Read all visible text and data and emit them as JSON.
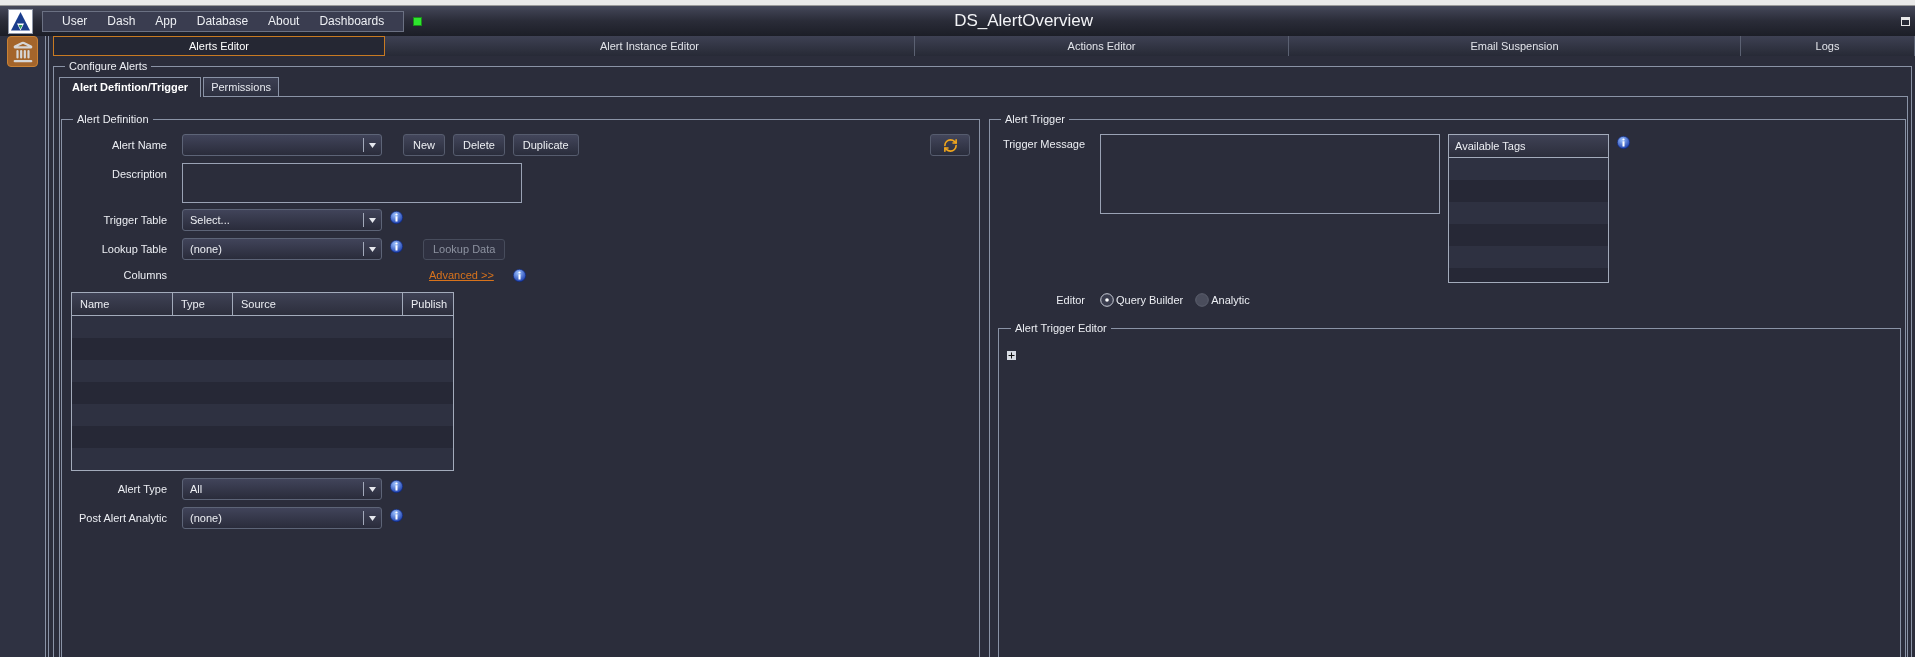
{
  "window": {
    "title": "DS_AlertOverview"
  },
  "menu": [
    {
      "label": "User"
    },
    {
      "label": "Dash"
    },
    {
      "label": "App"
    },
    {
      "label": "Database"
    },
    {
      "label": "About"
    },
    {
      "label": "Dashboards"
    }
  ],
  "status_light": {
    "on": true
  },
  "sidebar": {
    "items": [
      {
        "selected": true
      }
    ]
  },
  "tabs": [
    {
      "label": "Alerts Editor",
      "selected": true
    },
    {
      "label": "Alert Instance Editor",
      "selected": false
    },
    {
      "label": "Actions Editor",
      "selected": false
    },
    {
      "label": "Email Suspension",
      "selected": false
    },
    {
      "label": "Logs",
      "selected": false
    }
  ],
  "configure_alerts": {
    "title": "Configure Alerts",
    "tabs": [
      {
        "label": "Alert Defintion/Trigger",
        "selected": true
      },
      {
        "label": "Permissions",
        "selected": false
      }
    ],
    "alert_definition": {
      "title": "Alert Definition",
      "alert_name": {
        "label": "Alert Name"
      },
      "buttons": [
        {
          "label": "New"
        },
        {
          "label": "Delete"
        },
        {
          "label": "Duplicate"
        }
      ],
      "description": {
        "label": "Description"
      },
      "trigger_table": {
        "label": "Trigger Table",
        "value": "Select..."
      },
      "lookup_table": {
        "label": "Lookup Table",
        "value": "(none)"
      },
      "lookup_data_button": {
        "label": "Lookup Data",
        "disabled": true
      },
      "columns": {
        "label": "Columns",
        "advanced_link": "Advanced >>",
        "table": {
          "columns": [
            "Name",
            "Type",
            "Source",
            "Publish"
          ]
        }
      },
      "alert_type": {
        "label": "Alert Type",
        "value": "All"
      },
      "post_alert_analytic": {
        "label": "Post Alert Analytic",
        "value": "(none)"
      }
    },
    "alert_trigger": {
      "title": "Alert Trigger",
      "trigger_message": {
        "label": "Trigger Message"
      },
      "available_tags": {
        "header": "Available Tags"
      },
      "editor": {
        "label": "Editor",
        "options": [
          {
            "label": "Query Builder",
            "selected": true
          },
          {
            "label": "Analytic",
            "selected": false
          }
        ]
      },
      "trigger_editor": {
        "title": "Alert Trigger Editor"
      }
    }
  }
}
